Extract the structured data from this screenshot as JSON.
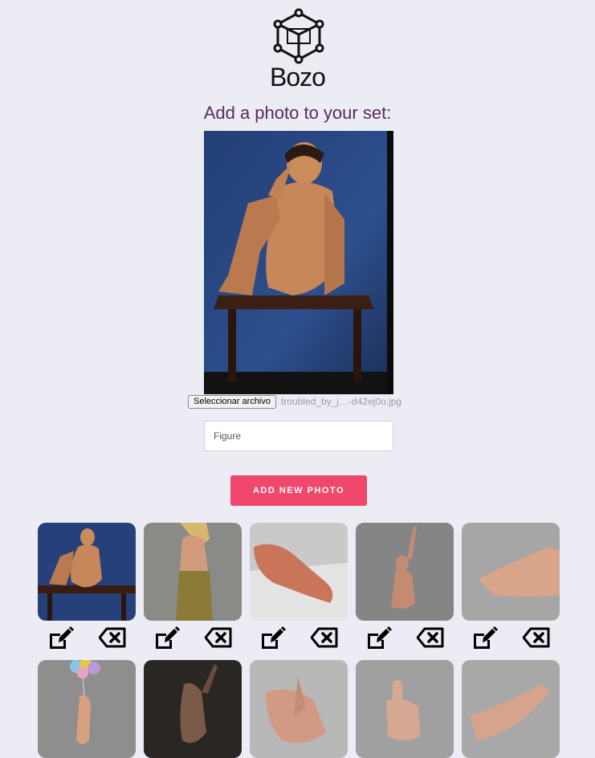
{
  "brand": {
    "name": "Bozo",
    "logo_icon": "cube-network-icon"
  },
  "page": {
    "heading": "Add a photo to your set:"
  },
  "upload": {
    "choose_button": "Seleccionar archivo",
    "file_name": "troubled_by_j…-d42ej0o.jpg",
    "category_value": "Figure",
    "category_placeholder": "Figure",
    "submit_label": "ADD NEW PHOTO"
  },
  "colors": {
    "accent": "#f0476d",
    "heading": "#5a2a5e",
    "background": "#ececf4"
  },
  "photos": [
    {
      "id": "p1",
      "subject": "seated-male-figure",
      "edit_icon": "edit-icon",
      "delete_icon": "delete-icon"
    },
    {
      "id": "p2",
      "subject": "standing-female-with-cloth",
      "edit_icon": "edit-icon",
      "delete_icon": "delete-icon"
    },
    {
      "id": "p3",
      "subject": "reclining-figure-on-sheet",
      "edit_icon": "edit-icon",
      "delete_icon": "delete-icon"
    },
    {
      "id": "p4",
      "subject": "kneeling-figure-arm-raised",
      "edit_icon": "edit-icon",
      "delete_icon": "delete-icon"
    },
    {
      "id": "p5",
      "subject": "reclining-figure-gray",
      "edit_icon": "edit-icon",
      "delete_icon": "delete-icon"
    },
    {
      "id": "p6",
      "subject": "figure-with-balloons"
    },
    {
      "id": "p7",
      "subject": "silhouette-figure"
    },
    {
      "id": "p8",
      "subject": "hands-study"
    },
    {
      "id": "p9",
      "subject": "thumbs-up-hand"
    },
    {
      "id": "p10",
      "subject": "open-hand-study"
    }
  ]
}
